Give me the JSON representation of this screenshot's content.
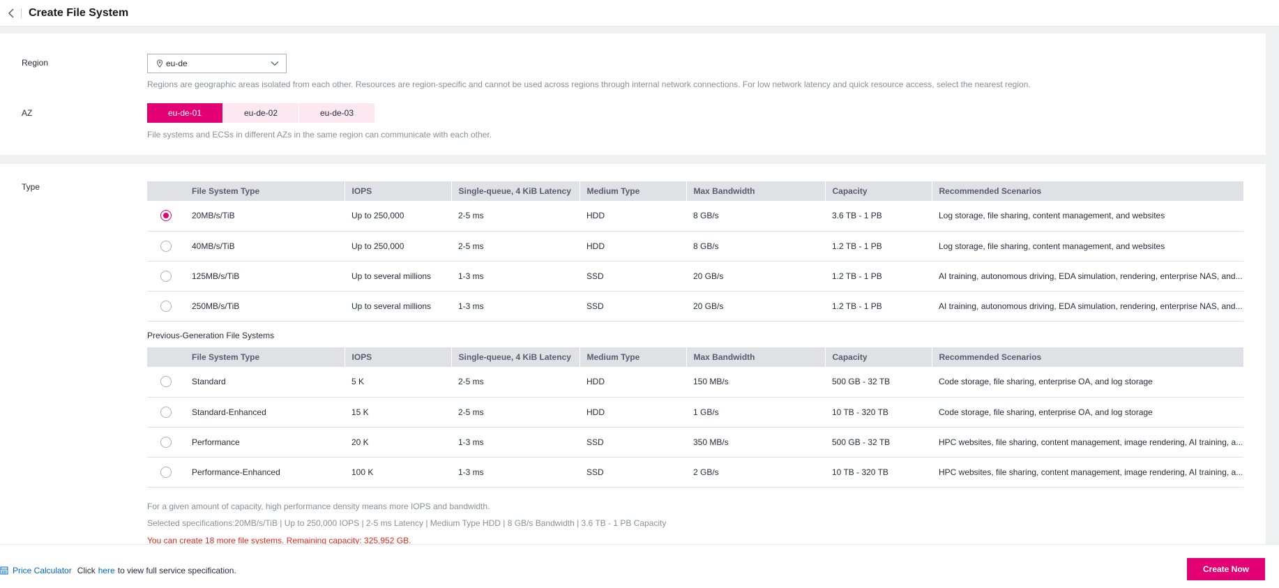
{
  "header": {
    "title": "Create File System"
  },
  "region": {
    "label": "Region",
    "value": "eu-de",
    "help": "Regions are geographic areas isolated from each other. Resources are region-specific and cannot be used across regions through internal network connections. For low network latency and quick resource access, select the nearest region."
  },
  "az": {
    "label": "AZ",
    "options": [
      "eu-de-01",
      "eu-de-02",
      "eu-de-03"
    ],
    "selected": "eu-de-01",
    "help": "File systems and ECSs in different AZs in the same region can communicate with each other."
  },
  "type": {
    "label": "Type",
    "columns": [
      "File System Type",
      "IOPS",
      "Single-queue, 4 KiB Latency",
      "Medium Type",
      "Max Bandwidth",
      "Capacity",
      "Recommended Scenarios"
    ],
    "rows": [
      {
        "name": "20MB/s/TiB",
        "iops": "Up to 250,000",
        "latency": "2-5 ms",
        "medium": "HDD",
        "bandwidth": "8 GB/s",
        "capacity": "3.6 TB - 1 PB",
        "scenarios": "Log storage, file sharing, content management, and websites",
        "selected": true
      },
      {
        "name": "40MB/s/TiB",
        "iops": "Up to 250,000",
        "latency": "2-5 ms",
        "medium": "HDD",
        "bandwidth": "8 GB/s",
        "capacity": "1.2 TB - 1 PB",
        "scenarios": "Log storage, file sharing, content management, and websites",
        "selected": false
      },
      {
        "name": "125MB/s/TiB",
        "iops": "Up to several millions",
        "latency": "1-3 ms",
        "medium": "SSD",
        "bandwidth": "20 GB/s",
        "capacity": "1.2 TB - 1 PB",
        "scenarios": "AI training, autonomous driving, EDA simulation, rendering, enterprise NAS, and...",
        "selected": false
      },
      {
        "name": "250MB/s/TiB",
        "iops": "Up to several millions",
        "latency": "1-3 ms",
        "medium": "SSD",
        "bandwidth": "20 GB/s",
        "capacity": "1.2 TB - 1 PB",
        "scenarios": "AI training, autonomous driving, EDA simulation, rendering, enterprise NAS, and...",
        "selected": false
      }
    ],
    "prev_gen_title": "Previous-Generation File Systems",
    "prev_gen_rows": [
      {
        "name": "Standard",
        "iops": "5 K",
        "latency": "2-5 ms",
        "medium": "HDD",
        "bandwidth": "150 MB/s",
        "capacity": "500 GB - 32 TB",
        "scenarios": "Code storage, file sharing, enterprise OA, and log storage",
        "selected": false
      },
      {
        "name": "Standard-Enhanced",
        "iops": "15 K",
        "latency": "2-5 ms",
        "medium": "HDD",
        "bandwidth": "1 GB/s",
        "capacity": "10 TB - 320 TB",
        "scenarios": "Code storage, file sharing, enterprise OA, and log storage",
        "selected": false
      },
      {
        "name": "Performance",
        "iops": "20 K",
        "latency": "1-3 ms",
        "medium": "SSD",
        "bandwidth": "350 MB/s",
        "capacity": "500 GB - 32 TB",
        "scenarios": "HPC websites, file sharing, content management, image rendering, AI training, a...",
        "selected": false
      },
      {
        "name": "Performance-Enhanced",
        "iops": "100 K",
        "latency": "1-3 ms",
        "medium": "SSD",
        "bandwidth": "2 GB/s",
        "capacity": "10 TB - 320 TB",
        "scenarios": "HPC websites, file sharing, content management, image rendering, AI training, a...",
        "selected": false
      }
    ],
    "note_density": "For a given amount of capacity, high performance density means more IOPS and bandwidth.",
    "selected_specs": "Selected specifications:20MB/s/TiB | Up to 250,000 IOPS | 2-5 ms Latency | Medium Type HDD | 8 GB/s Bandwidth | 3.6 TB - 1 PB Capacity",
    "quota_note": "You can create 18 more file systems. Remaining capacity: 325,952 GB."
  },
  "footer": {
    "price_calculator": "Price Calculator",
    "click_text": "Click",
    "here_link": "here",
    "spec_text": "to view full service specification.",
    "create_button": "Create Now"
  },
  "colors": {
    "accent": "#e20074",
    "accent_light": "#fde7f1",
    "error": "#e0291d",
    "link": "#0066cc"
  },
  "icons": {
    "back": "chevron-left-icon",
    "region": "location-pin-icon",
    "dropdown": "chevron-down-icon",
    "calculator": "calculator-icon"
  }
}
